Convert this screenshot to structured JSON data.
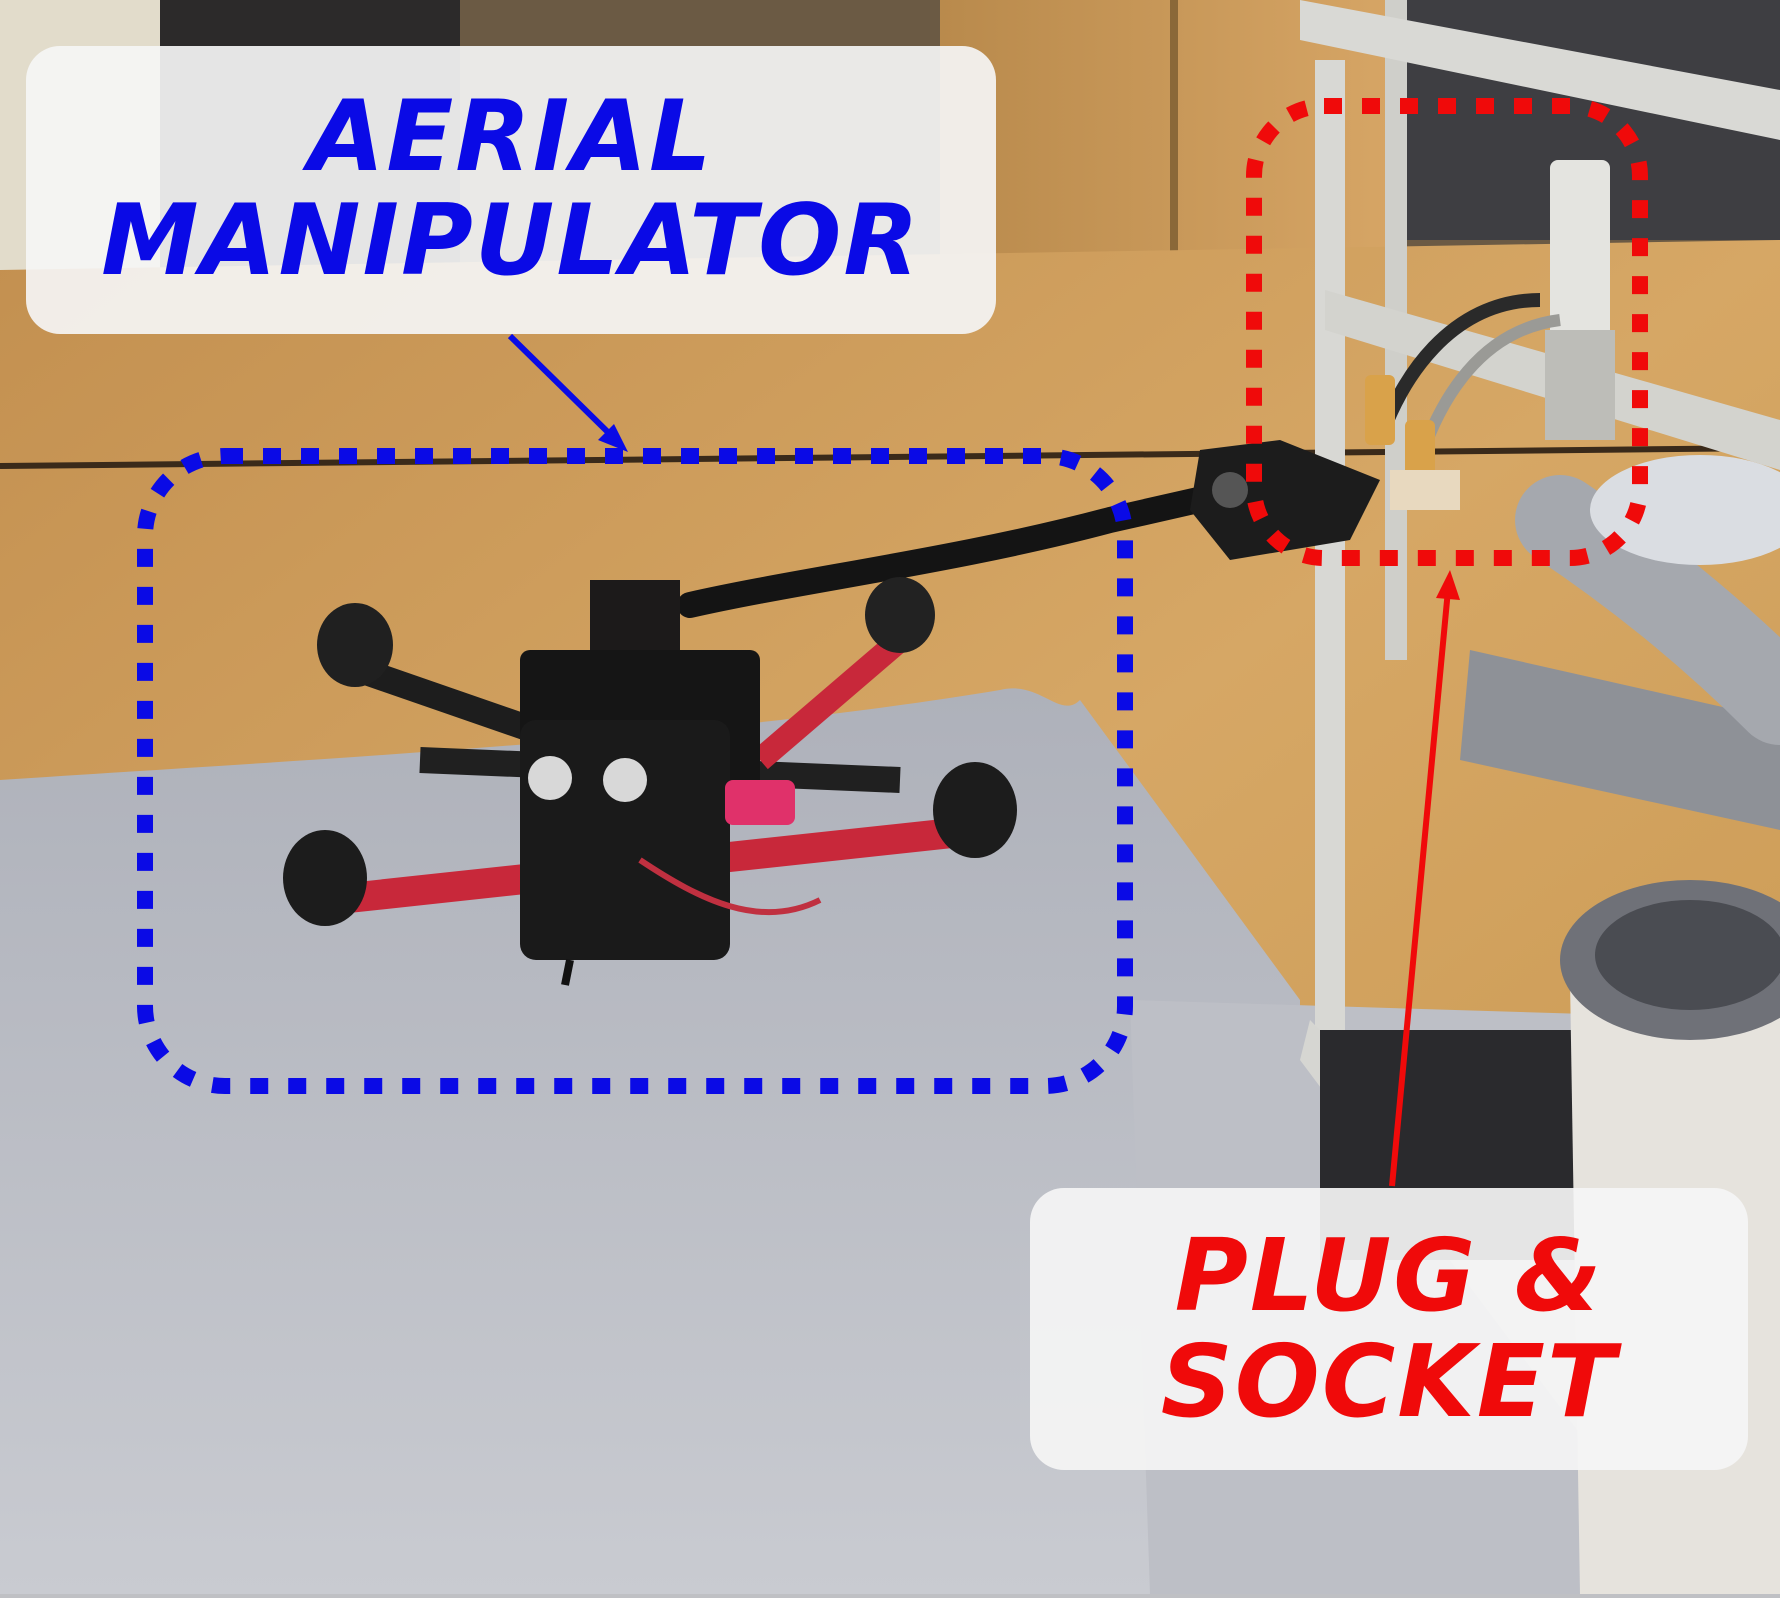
{
  "annotations": {
    "aerial_manipulator": {
      "lines": [
        "AERIAL",
        "MANIPULATOR"
      ],
      "color": "#0a0ae6"
    },
    "plug_socket": {
      "lines": [
        "PLUG &",
        "SOCKET"
      ],
      "color": "#f00a0a"
    }
  },
  "photo": {
    "subject": "quadrotor aerial manipulator inserting plug into socket",
    "colors": {
      "wall_wood": "#c99a5c",
      "floor_mat": "#b9bcc4",
      "frame_metal": "#d9d9d6",
      "drone_body": "#1a1a1a",
      "drone_wire": "#c8283a"
    }
  }
}
